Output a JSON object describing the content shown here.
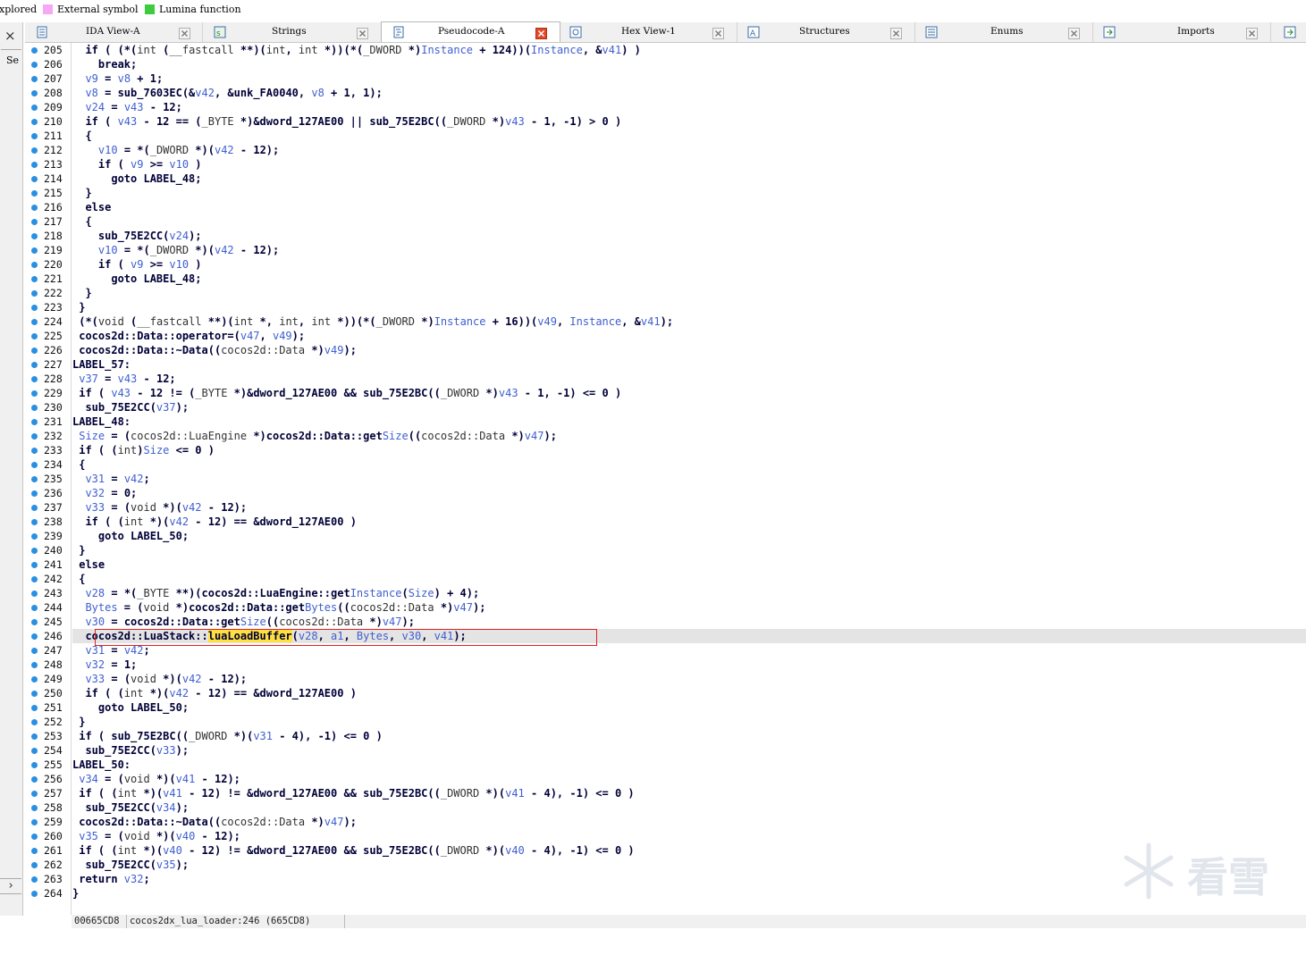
{
  "legend": {
    "items": [
      {
        "label": "xplored",
        "color": ""
      },
      {
        "label": "External symbol",
        "color": "#f7a8f5"
      },
      {
        "label": "Lumina function",
        "color": "#3dcc3d"
      }
    ]
  },
  "left_panel": {
    "close_glyph": "×",
    "truncated_label": "Se",
    "expand_glyph": "›"
  },
  "tabs": [
    {
      "label": "IDA View-A",
      "active": false
    },
    {
      "label": "Strings",
      "active": false
    },
    {
      "label": "Pseudocode-A",
      "active": true
    },
    {
      "label": "Hex View-1",
      "active": false
    },
    {
      "label": "Structures",
      "active": false
    },
    {
      "label": "Enums",
      "active": false
    },
    {
      "label": "Imports",
      "active": false
    }
  ],
  "colors": {
    "breakpoint_dot": "#2b8fe0",
    "variable": "#3f5fd0",
    "code_text": "#000038",
    "highlight_box": "#e02020",
    "cursor_highlight": "#ffe040"
  },
  "code_lines": [
    {
      "n": "205",
      "text": "  if ( (*(int (__fastcall **)(int, int *))(*(_DWORD *)Instance + 124))(Instance, &v41) )"
    },
    {
      "n": "206",
      "text": "    break;"
    },
    {
      "n": "207",
      "text": "  v9 = v8 + 1;"
    },
    {
      "n": "208",
      "text": "  v8 = sub_7603EC(&v42, &unk_FA0040, v8 + 1, 1);"
    },
    {
      "n": "209",
      "text": "  v24 = v43 - 12;"
    },
    {
      "n": "210",
      "text": "  if ( v43 - 12 == (_BYTE *)&dword_127AE00 || sub_75E2BC((_DWORD *)v43 - 1, -1) > 0 )"
    },
    {
      "n": "211",
      "text": "  {"
    },
    {
      "n": "212",
      "text": "    v10 = *(_DWORD *)(v42 - 12);"
    },
    {
      "n": "213",
      "text": "    if ( v9 >= v10 )"
    },
    {
      "n": "214",
      "text": "      goto LABEL_48;"
    },
    {
      "n": "215",
      "text": "  }"
    },
    {
      "n": "216",
      "text": "  else"
    },
    {
      "n": "217",
      "text": "  {"
    },
    {
      "n": "218",
      "text": "    sub_75E2CC(v24);"
    },
    {
      "n": "219",
      "text": "    v10 = *(_DWORD *)(v42 - 12);"
    },
    {
      "n": "220",
      "text": "    if ( v9 >= v10 )"
    },
    {
      "n": "221",
      "text": "      goto LABEL_48;"
    },
    {
      "n": "222",
      "text": "  }"
    },
    {
      "n": "223",
      "text": " }"
    },
    {
      "n": "224",
      "text": " (*(void (__fastcall **)(int *, int, int *))(*(_DWORD *)Instance + 16))(v49, Instance, &v41);"
    },
    {
      "n": "225",
      "text": " cocos2d::Data::operator=(v47, v49);"
    },
    {
      "n": "226",
      "text": " cocos2d::Data::~Data((cocos2d::Data *)v49);"
    },
    {
      "n": "227",
      "text": "LABEL_57:"
    },
    {
      "n": "228",
      "text": " v37 = v43 - 12;"
    },
    {
      "n": "229",
      "text": " if ( v43 - 12 != (_BYTE *)&dword_127AE00 && sub_75E2BC((_DWORD *)v43 - 1, -1) <= 0 )"
    },
    {
      "n": "230",
      "text": "  sub_75E2CC(v37);"
    },
    {
      "n": "231",
      "text": "LABEL_48:"
    },
    {
      "n": "232",
      "text": " Size = (cocos2d::LuaEngine *)cocos2d::Data::getSize((cocos2d::Data *)v47);"
    },
    {
      "n": "233",
      "text": " if ( (int)Size <= 0 )"
    },
    {
      "n": "234",
      "text": " {"
    },
    {
      "n": "235",
      "text": "  v31 = v42;"
    },
    {
      "n": "236",
      "text": "  v32 = 0;"
    },
    {
      "n": "237",
      "text": "  v33 = (void *)(v42 - 12);"
    },
    {
      "n": "238",
      "text": "  if ( (int *)(v42 - 12) == &dword_127AE00 )"
    },
    {
      "n": "239",
      "text": "    goto LABEL_50;"
    },
    {
      "n": "240",
      "text": " }"
    },
    {
      "n": "241",
      "text": " else"
    },
    {
      "n": "242",
      "text": " {"
    },
    {
      "n": "243",
      "text": "  v28 = *(_BYTE **)(cocos2d::LuaEngine::getInstance(Size) + 4);"
    },
    {
      "n": "244",
      "text": "  Bytes = (void *)cocos2d::Data::getBytes((cocos2d::Data *)v47);"
    },
    {
      "n": "245",
      "text": "  v30 = cocos2d::Data::getSize((cocos2d::Data *)v47);"
    },
    {
      "n": "246",
      "text": "  cocos2d::LuaStack::luaLoadBuffer(v28, a1, Bytes, v30, v41);"
    },
    {
      "n": "247",
      "text": "  v31 = v42;"
    },
    {
      "n": "248",
      "text": "  v32 = 1;"
    },
    {
      "n": "249",
      "text": "  v33 = (void *)(v42 - 12);"
    },
    {
      "n": "250",
      "text": "  if ( (int *)(v42 - 12) == &dword_127AE00 )"
    },
    {
      "n": "251",
      "text": "    goto LABEL_50;"
    },
    {
      "n": "252",
      "text": " }"
    },
    {
      "n": "253",
      "text": " if ( sub_75E2BC((_DWORD *)(v31 - 4), -1) <= 0 )"
    },
    {
      "n": "254",
      "text": "  sub_75E2CC(v33);"
    },
    {
      "n": "255",
      "text": "LABEL_50:"
    },
    {
      "n": "256",
      "text": " v34 = (void *)(v41 - 12);"
    },
    {
      "n": "257",
      "text": " if ( (int *)(v41 - 12) != &dword_127AE00 && sub_75E2BC((_DWORD *)(v41 - 4), -1) <= 0 )"
    },
    {
      "n": "258",
      "text": "  sub_75E2CC(v34);"
    },
    {
      "n": "259",
      "text": " cocos2d::Data::~Data((cocos2d::Data *)v47);"
    },
    {
      "n": "260",
      "text": " v35 = (void *)(v40 - 12);"
    },
    {
      "n": "261",
      "text": " if ( (int *)(v40 - 12) != &dword_127AE00 && sub_75E2BC((_DWORD *)(v40 - 4), -1) <= 0 )"
    },
    {
      "n": "262",
      "text": "  sub_75E2CC(v35);"
    },
    {
      "n": "263",
      "text": " return v32;"
    },
    {
      "n": "264",
      "text": "}"
    }
  ],
  "highlighted_line": "246",
  "status": {
    "address": "00665CD8",
    "location": "cocos2dx_lua_loader:246 (665CD8)"
  },
  "watermark": {
    "text": "看雪"
  }
}
